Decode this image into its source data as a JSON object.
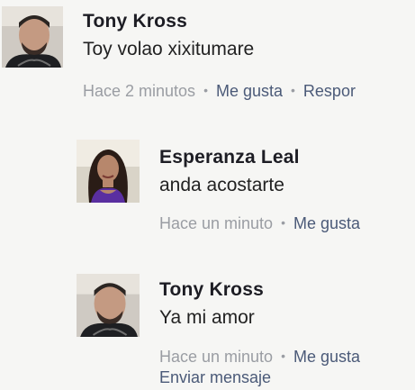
{
  "comments": [
    {
      "author": "Tony Kross",
      "text": "Toy volao xixitumare",
      "time": "Hace 2 minutos",
      "like": "Me gusta",
      "reply": "Respor"
    },
    {
      "author": "Esperanza Leal",
      "text": "anda acostarte",
      "time": "Hace un minuto",
      "like": "Me gusta"
    },
    {
      "author": "Tony Kross",
      "text": "Ya mi amor",
      "time": "Hace un minuto",
      "like": "Me gusta",
      "message": "Enviar mensaje"
    }
  ],
  "colors": {
    "background": "#f6f6f4",
    "author": "#1d1d24",
    "meta": "#9a9da3",
    "action": "#4b5a78"
  }
}
